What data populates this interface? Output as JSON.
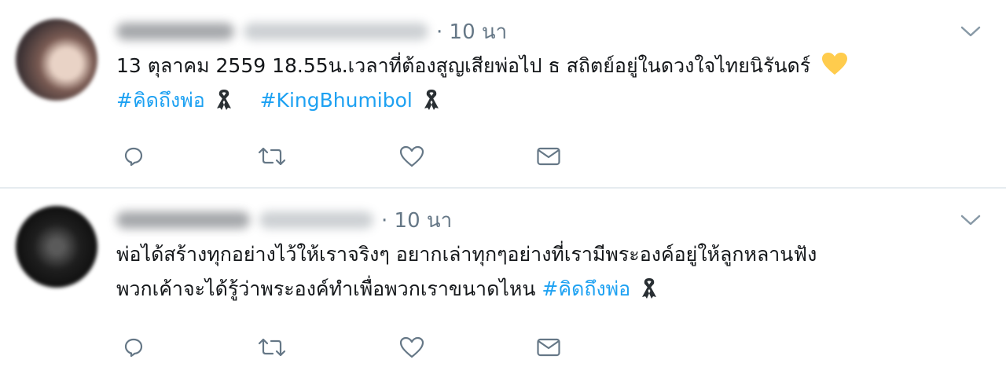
{
  "tweets": [
    {
      "time": "· 10 นา",
      "text": "13 ตุลาคม 2559 18.55น.เวลาที่ต้องสูญเสียพ่อไป ธ สถิตย์อยู่ในดวงใจไทยนิรันดร์",
      "hashtags": [
        "#คิดถึงพ่อ",
        "#KingBhumibol"
      ],
      "icons": [
        "yellow-heart-icon",
        "black-ribbon-icon"
      ]
    },
    {
      "time": "· 10 นา",
      "line1": "พ่อได้สร้างทุกอย่างไว้ให้เราจริงๆ อยากเล่าทุกๆอย่างที่เรามีพระองค์อยู่ให้ลูกหลานฟัง",
      "line2": "พวกเค้าจะได้รู้ว่าพระองค์ทำเพื่อพวกเราขนาดไหน",
      "hashtags": [
        "#คิดถึงพ่อ"
      ],
      "icons": [
        "black-ribbon-icon"
      ]
    }
  ],
  "actions": [
    "reply-icon",
    "retweet-icon",
    "like-icon",
    "direct-message-icon"
  ],
  "colors": {
    "link": "#1da1f2",
    "muted": "#657786",
    "divider": "#e6ecf0",
    "text": "#14171a"
  }
}
